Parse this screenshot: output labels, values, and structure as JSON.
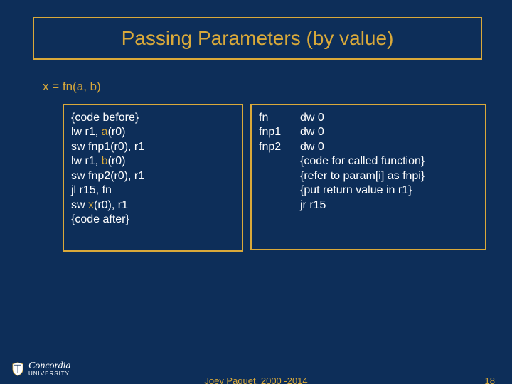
{
  "title": "Passing Parameters (by value)",
  "expression": {
    "prefix": "x = fn(",
    "a": "a",
    "mid": ", ",
    "b": "b",
    "suffix": ")"
  },
  "left": {
    "l1": "{code before}",
    "l2p": "lw r1, ",
    "l2h": "a",
    "l2s": "(r0)",
    "l3": "sw fnp1(r0), r1",
    "l4p": "lw r1, ",
    "l4h": "b",
    "l4s": "(r0)",
    "l5": "sw fnp2(r0), r1",
    "l6": "jl r15, fn",
    "l7p": "sw ",
    "l7h": "x",
    "l7s": "(r0), r1",
    "l8": "{code after}"
  },
  "right": {
    "r1a": "fn",
    "r1b": "dw 0",
    "r2a": "fnp1",
    "r2b": "dw 0",
    "r3a": "fnp2",
    "r3b": "dw 0",
    "r4": "{code for called function}",
    "r5": "{refer to param[i] as fnpi}",
    "r6": "{put return value in r1}",
    "r7": "jr r15"
  },
  "footer": {
    "author": "Joey Paquet, 2000 -2014",
    "page": "18"
  },
  "logo": {
    "name": "Concordia",
    "sub": "UNIVERSITY"
  }
}
